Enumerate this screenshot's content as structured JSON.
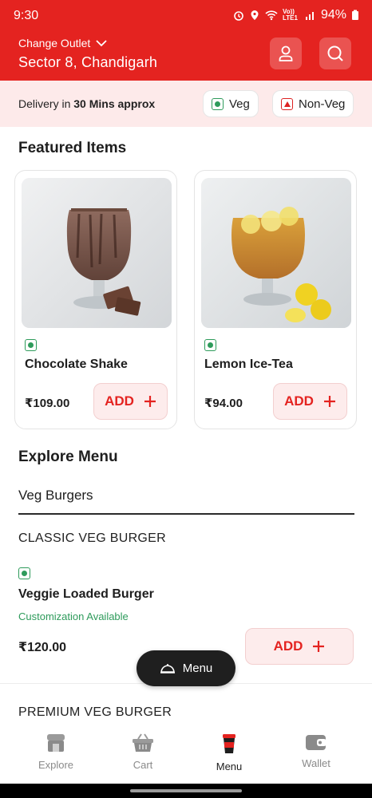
{
  "status_bar": {
    "time": "9:30",
    "network": "Vo)) LTE1",
    "battery": "94%"
  },
  "header": {
    "change_outlet_label": "Change Outlet",
    "location": "Sector 8, Chandigarh",
    "background_color": "#e42320",
    "profile_icon": "user-icon",
    "search_icon": "search-icon"
  },
  "delivery": {
    "prefix": "Delivery in ",
    "eta": "30 Mins approx",
    "filters": [
      {
        "label": "Veg"
      },
      {
        "label": "Non-Veg"
      }
    ]
  },
  "featured": {
    "title": "Featured Items",
    "items": [
      {
        "name": "Chocolate Shake",
        "price": "₹109.00",
        "add_label": "ADD",
        "diet": "veg"
      },
      {
        "name": "Lemon Ice-Tea",
        "price": "₹94.00",
        "add_label": "ADD",
        "diet": "veg"
      }
    ]
  },
  "explore": {
    "title": "Explore Menu",
    "category": "Veg Burgers",
    "subcategories": [
      "CLASSIC VEG BURGER",
      "PREMIUM VEG BURGER"
    ],
    "items": [
      {
        "name": "Veggie Loaded Burger",
        "customization": "Customization Available",
        "price": "₹120.00",
        "add_label": "ADD",
        "diet": "veg"
      }
    ]
  },
  "floating_menu": {
    "label": "Menu"
  },
  "bottom_nav": {
    "active": "Menu",
    "items": [
      {
        "label": "Explore",
        "icon": "store-icon"
      },
      {
        "label": "Cart",
        "icon": "basket-icon"
      },
      {
        "label": "Menu",
        "icon": "cup-icon"
      },
      {
        "label": "Wallet",
        "icon": "wallet-icon"
      }
    ]
  },
  "colors": {
    "brand_red": "#e42320",
    "veg_green": "#2e9b5b",
    "add_bg": "#fdecec"
  }
}
